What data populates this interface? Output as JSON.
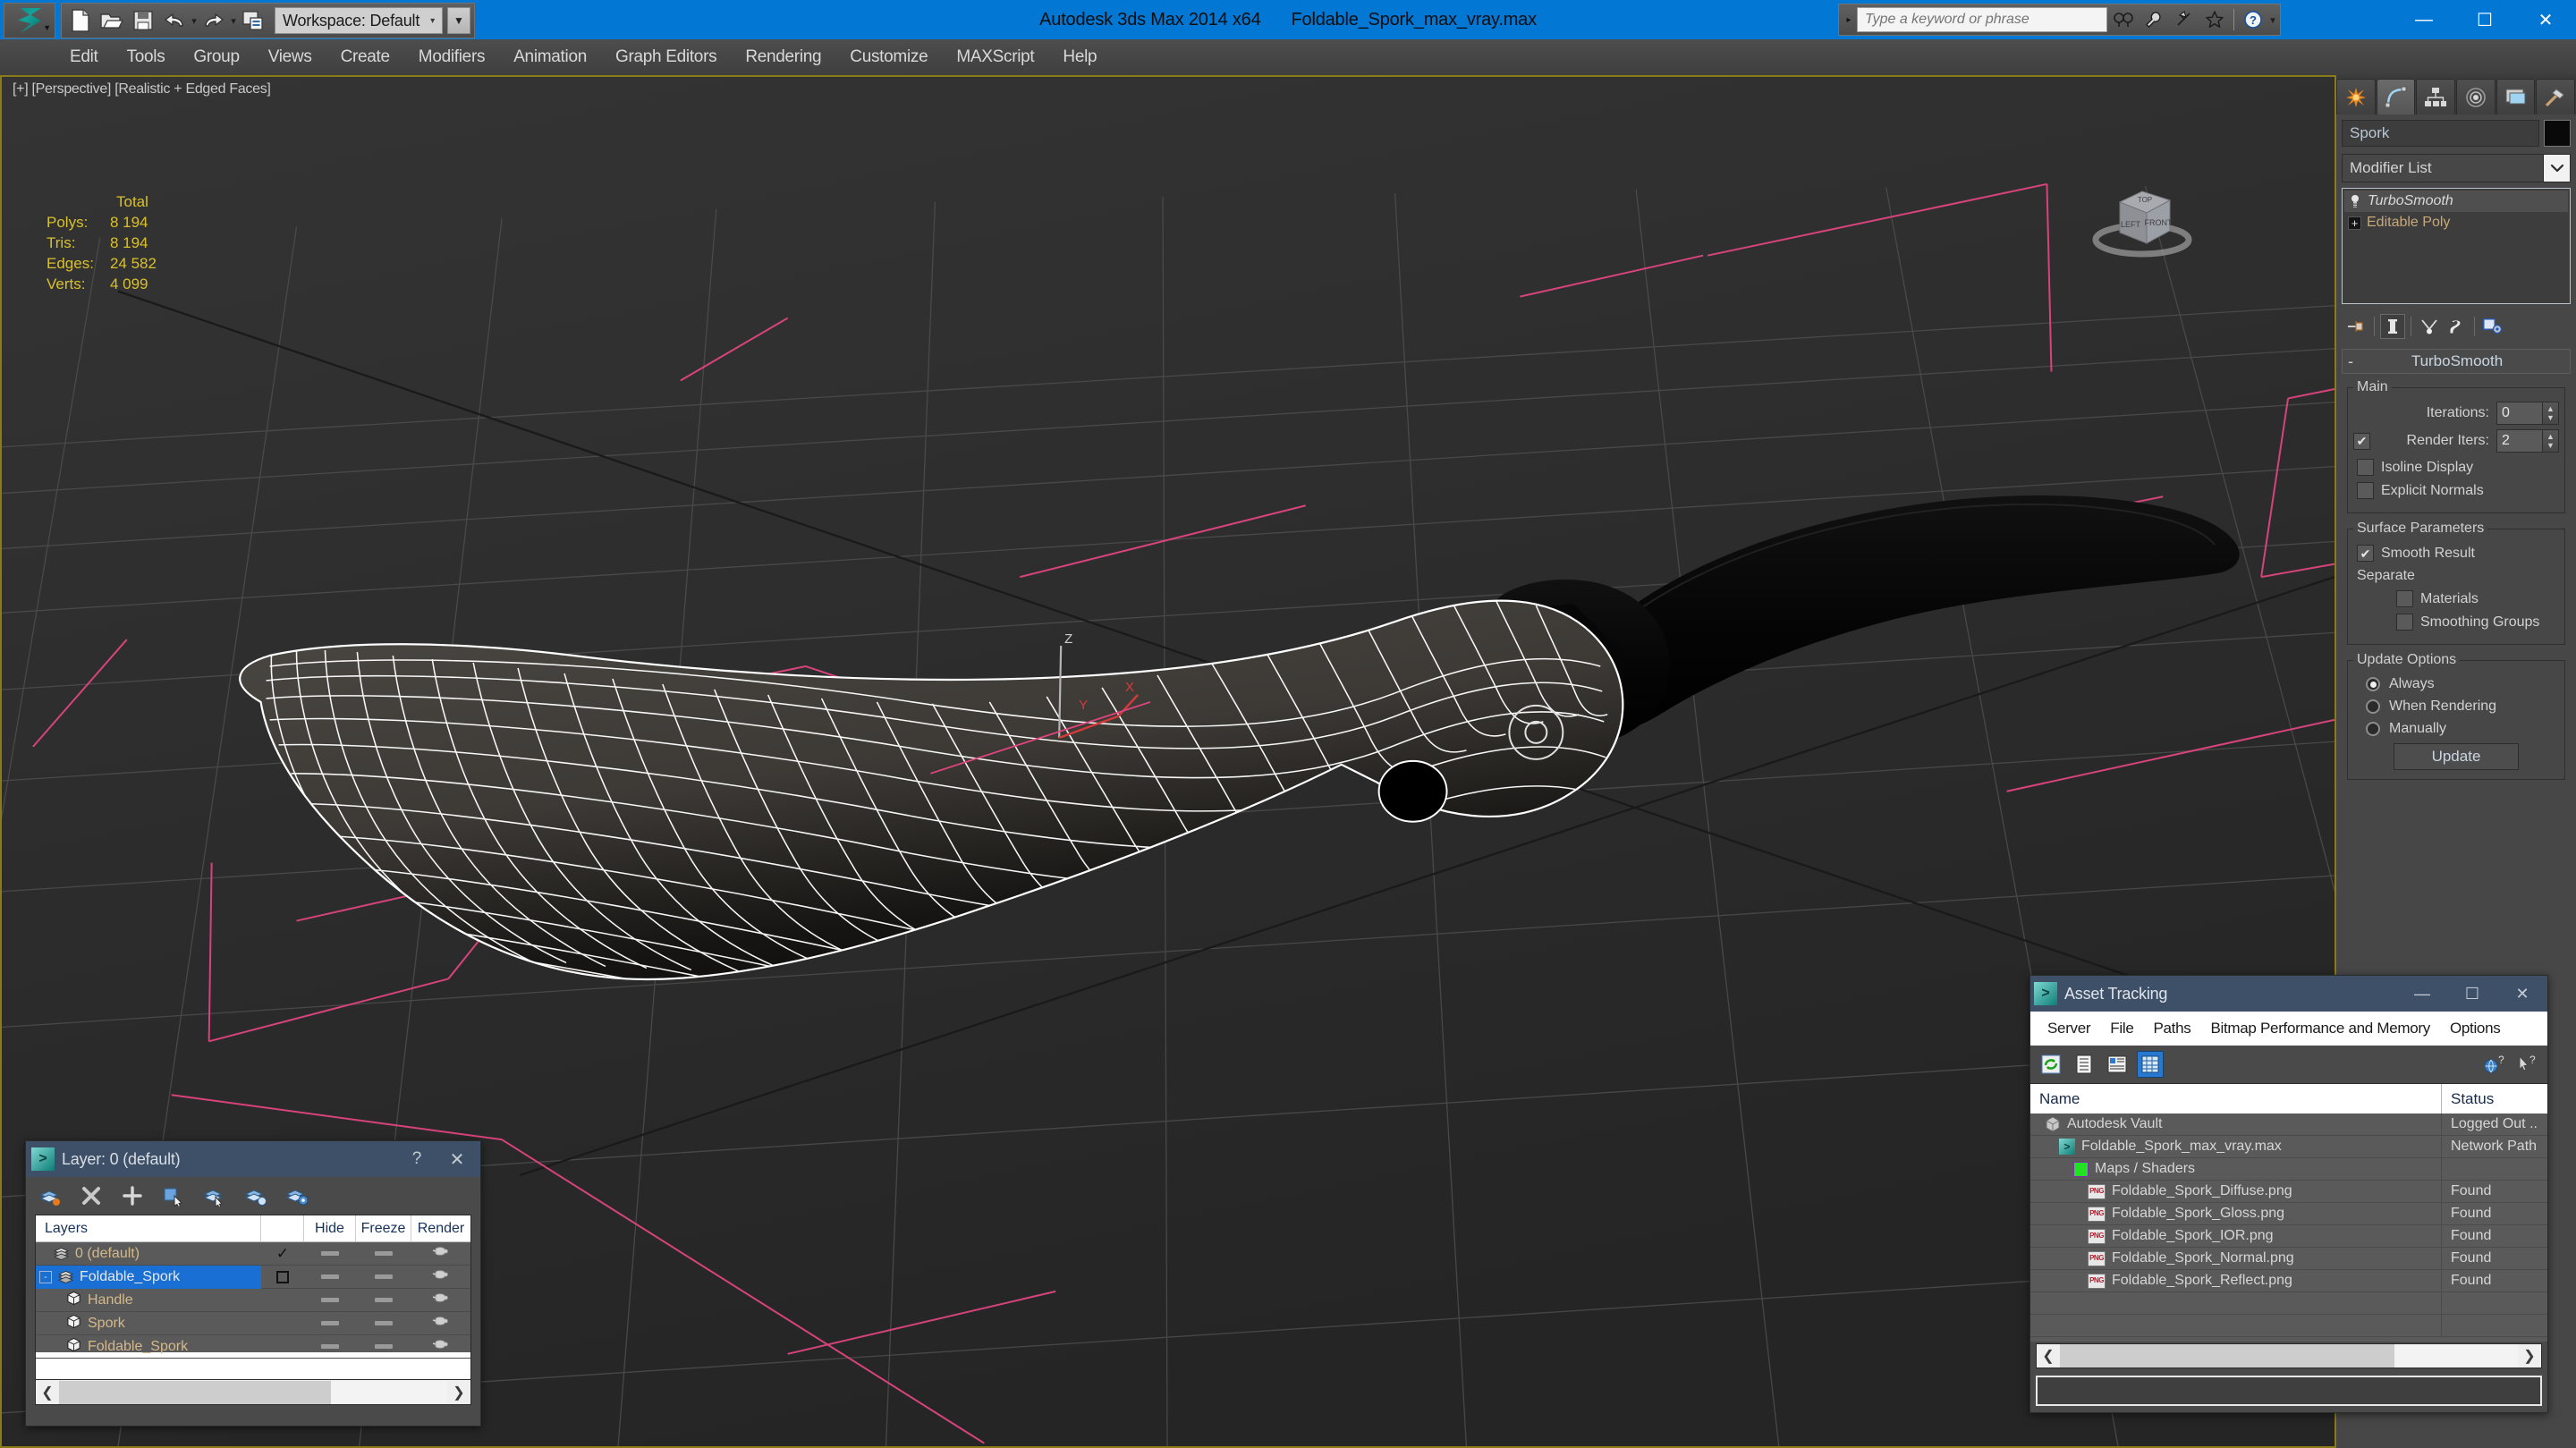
{
  "titlebar": {
    "app_title": "Autodesk 3ds Max  2014 x64",
    "file_title": "Foldable_Spork_max_vray.max",
    "workspace_label": "Workspace: Default",
    "quick_access": [
      {
        "name": "new-file-icon",
        "label": "New"
      },
      {
        "name": "open-file-icon",
        "label": "Open"
      },
      {
        "name": "save-file-icon",
        "label": "Save"
      },
      {
        "name": "undo-icon",
        "label": "Undo"
      },
      {
        "name": "redo-icon",
        "label": "Redo"
      },
      {
        "name": "project-folder-icon",
        "label": "Set Project Folder"
      }
    ],
    "search_placeholder": "Type a keyword or phrase",
    "search_buttons": [
      "search-icon",
      "wrench-icon",
      "satellite-icon",
      "star-icon",
      "help-icon"
    ],
    "window_buttons": {
      "minimize": "—",
      "maximize": "☐",
      "close": "✕"
    }
  },
  "menubar": {
    "items": [
      "Edit",
      "Tools",
      "Group",
      "Views",
      "Create",
      "Modifiers",
      "Animation",
      "Graph Editors",
      "Rendering",
      "Customize",
      "MAXScript",
      "Help"
    ]
  },
  "viewport": {
    "label": "[+] [Perspective] [Realistic + Edged Faces]",
    "stats": {
      "header": "Total",
      "rows": [
        {
          "label": "Polys:",
          "value": "8 194"
        },
        {
          "label": "Tris:",
          "value": "8 194"
        },
        {
          "label": "Edges:",
          "value": "24 582"
        },
        {
          "label": "Verts:",
          "value": "4 099"
        }
      ]
    },
    "viewcube_faces": {
      "front": "FRONT",
      "left": "LEFT",
      "top": "TOP"
    }
  },
  "command_panel": {
    "tabs": [
      {
        "name": "create-tab",
        "icon": "star-burst-icon",
        "active": false
      },
      {
        "name": "modify-tab",
        "icon": "curve-icon",
        "active": true
      },
      {
        "name": "hierarchy-tab",
        "icon": "hierarchy-icon",
        "active": false
      },
      {
        "name": "motion-tab",
        "icon": "motion-icon",
        "active": false
      },
      {
        "name": "display-tab",
        "icon": "display-icon",
        "active": false
      },
      {
        "name": "utilities-tab",
        "icon": "hammer-icon",
        "active": false
      }
    ],
    "object_name": "Spork",
    "modifier_list_label": "Modifier List",
    "modifier_stack": [
      {
        "label": "TurboSmooth",
        "selected": true,
        "icon": "lightbulb-icon"
      },
      {
        "label": "Editable Poly",
        "selected": false,
        "icon": "plus-expand-icon"
      }
    ],
    "stack_tools": [
      "pin-stack-icon",
      "show-end-result-icon",
      "make-unique-icon",
      "remove-modifier-icon",
      "configure-modifier-sets-icon"
    ],
    "rollout": {
      "title": "TurboSmooth",
      "collapse_glyph": "-",
      "groups": {
        "main": {
          "legend": "Main",
          "iterations_label": "Iterations:",
          "iterations_value": "0",
          "render_iters_label": "Render Iters:",
          "render_iters_value": "2",
          "render_iters_checked": true,
          "isoline_display_label": "Isoline Display",
          "isoline_display_checked": false,
          "explicit_normals_label": "Explicit Normals",
          "explicit_normals_checked": false
        },
        "surface": {
          "legend": "Surface Parameters",
          "smooth_result_label": "Smooth Result",
          "smooth_result_checked": true,
          "separate_label": "Separate",
          "materials_label": "Materials",
          "materials_checked": false,
          "smoothing_groups_label": "Smoothing Groups",
          "smoothing_groups_checked": false
        },
        "update": {
          "legend": "Update Options",
          "options": [
            {
              "label": "Always",
              "selected": true
            },
            {
              "label": "When Rendering",
              "selected": false
            },
            {
              "label": "Manually",
              "selected": false
            }
          ],
          "update_button": "Update"
        }
      }
    }
  },
  "layer_dialog": {
    "title": "Layer: 0 (default)",
    "help_glyph": "?",
    "close_glyph": "✕",
    "toolbar": [
      {
        "name": "create-new-layer-icon"
      },
      {
        "name": "delete-layer-icon"
      },
      {
        "name": "add-selection-to-layer-icon"
      },
      {
        "name": "select-objects-in-layer-icon"
      },
      {
        "name": "select-highlighted-layers-icon"
      },
      {
        "name": "highlight-selected-objects-layer-icon"
      },
      {
        "name": "layer-properties-icon"
      }
    ],
    "columns": {
      "name": "Layers",
      "check": "",
      "hide": "Hide",
      "freeze": "Freeze",
      "render": "Render"
    },
    "rows": [
      {
        "label": "0 (default)",
        "indent": 1,
        "type": "layer",
        "current": true,
        "selected": false,
        "expander": ""
      },
      {
        "label": "Foldable_Spork",
        "indent": 0,
        "type": "layer",
        "current": false,
        "selected": true,
        "expander": "-"
      },
      {
        "label": "Handle",
        "indent": 2,
        "type": "node",
        "current": false,
        "selected": false,
        "expander": ""
      },
      {
        "label": "Spork",
        "indent": 2,
        "type": "node",
        "current": false,
        "selected": false,
        "expander": ""
      },
      {
        "label": "Foldable_Spork",
        "indent": 2,
        "type": "node",
        "current": false,
        "selected": false,
        "expander": ""
      }
    ]
  },
  "asset_tracking": {
    "title": "Asset Tracking",
    "window_buttons": {
      "minimize": "—",
      "maximize": "☐",
      "close": "✕"
    },
    "menus": [
      "Server",
      "File",
      "Paths",
      "Bitmap Performance and Memory",
      "Options"
    ],
    "toolbar": [
      {
        "name": "refresh-icon",
        "active": false
      },
      {
        "name": "list-view-icon",
        "active": false
      },
      {
        "name": "detail-view-icon",
        "active": false
      },
      {
        "name": "grid-view-icon",
        "active": true
      }
    ],
    "help_icons": [
      "help-globe-icon",
      "help-cursor-icon"
    ],
    "columns": {
      "name": "Name",
      "status": "Status"
    },
    "rows": [
      {
        "name": "Autodesk Vault",
        "status": "Logged Out ..",
        "indent": 1,
        "icon": "vault-icon"
      },
      {
        "name": "Foldable_Spork_max_vray.max",
        "status": "Network Path",
        "indent": 2,
        "icon": "max-file-icon"
      },
      {
        "name": "Maps / Shaders",
        "status": "",
        "indent": 3,
        "icon": "maps-shaders-icon"
      },
      {
        "name": "Foldable_Spork_Diffuse.png",
        "status": "Found",
        "indent": 4,
        "icon": "png-file-icon"
      },
      {
        "name": "Foldable_Spork_Gloss.png",
        "status": "Found",
        "indent": 4,
        "icon": "png-file-icon"
      },
      {
        "name": "Foldable_Spork_IOR.png",
        "status": "Found",
        "indent": 4,
        "icon": "png-file-icon"
      },
      {
        "name": "Foldable_Spork_Normal.png",
        "status": "Found",
        "indent": 4,
        "icon": "png-file-icon"
      },
      {
        "name": "Foldable_Spork_Reflect.png",
        "status": "Found",
        "indent": 4,
        "icon": "png-file-icon"
      }
    ],
    "status_bar_text": ""
  },
  "colors": {
    "titlebar_blue": "#0277d4",
    "viewport_bg": "#2e2e2e",
    "viewport_border": "#8a7a18",
    "panel_bg": "#474747",
    "stats_yellow": "#d9c02b",
    "selection_blue": "#1a6fd4",
    "dialog_titlebar": "#3d5068",
    "grid_line": "#4a4a4a",
    "axis_pink": "#d9427e",
    "wireframe": "#ffffff"
  }
}
